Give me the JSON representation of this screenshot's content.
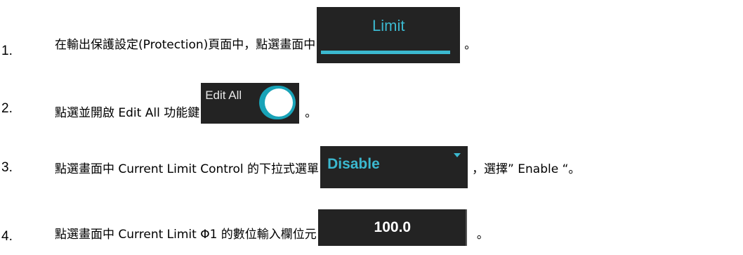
{
  "steps": [
    {
      "number": "1.",
      "text_before": "在輸出保護設定(Protection)頁面中，點選畫面中",
      "text_after": "。",
      "widget": {
        "label": "Limit",
        "accent": "#3bb8cf"
      }
    },
    {
      "number": "2.",
      "text_before": "點選並開啟 Edit All 功能鍵",
      "text_after": "。",
      "widget": {
        "label": "Edit All",
        "state": "on",
        "accent": "#18a3b8"
      }
    },
    {
      "number": "3.",
      "text_before": "點選畫面中 Current Limit Control 的下拉式選單",
      "text_after": "，選擇” Enable “。",
      "widget": {
        "label": "Disable",
        "icon": "dropdown-caret-icon",
        "accent": "#3bb8cf"
      }
    },
    {
      "number": "4.",
      "text_before": "點選畫面中 Current Limit Φ1 的數位輸入欄位元",
      "text_after": "。",
      "widget": {
        "label": "100.0"
      }
    }
  ],
  "colors": {
    "widget_background": "#232323"
  }
}
